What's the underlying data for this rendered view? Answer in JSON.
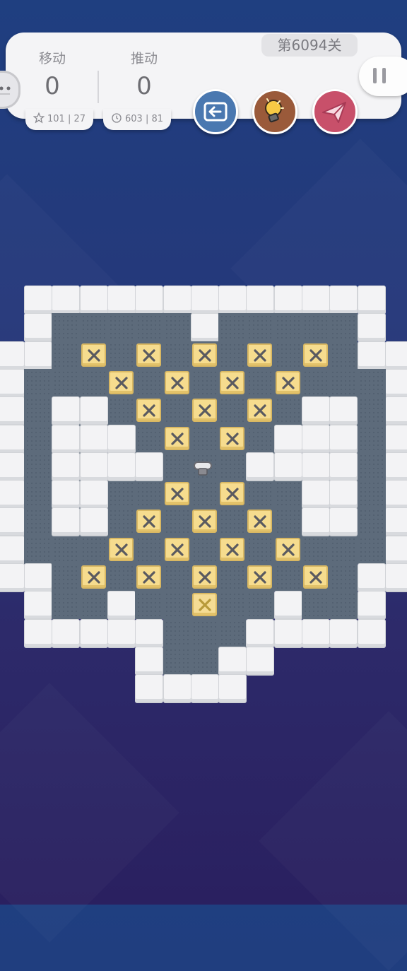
{
  "header": {
    "moves_label": "移动",
    "moves_value": "0",
    "pushes_label": "推动",
    "pushes_value": "0",
    "level_label": "第6094关",
    "star_stat": "101 | 27",
    "time_stat": "603 | 81"
  },
  "toolbar": {
    "undo_icon": "arrow-left-icon",
    "hint_icon": "lightbulb-icon",
    "send_icon": "paper-plane-icon",
    "pause_icon": "pause-icon"
  },
  "colors": {
    "background_top": "#1f3f80",
    "background_bottom": "#2a2060",
    "floor": "#5d6b7b",
    "wall": "#f3f3f5",
    "box": "#f6dc8e",
    "undo": "#4a78b0",
    "hint": "#9a5a3a",
    "send": "#c8506a"
  },
  "game": {
    "legend": "#=wall .=floor B=box T=target P=player",
    "map": [
      "#############",
      "#.....#.....#",
      "##B.B.B.B.B.##",
      "#..B.B.B.B...#",
      "#.##.B.B.B.##.#",
      "#.##..B.B..##.#",
      "#.###..P..##..#",
      "#.##..B.B..##.#",
      "#.##.B.B.B.##.#",
      "#...B.B.B.B...#",
      "##B.B.B.B.B.##",
      "#..#..T..#..#",
      "#####....####",
      "#....###",
      "#####"
    ]
  }
}
